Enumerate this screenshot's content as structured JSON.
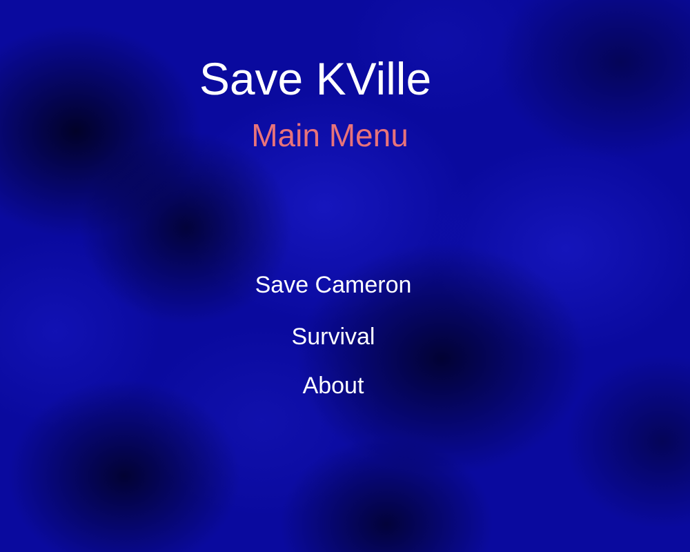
{
  "game": {
    "title": "Save KVille",
    "subtitle": "Main Menu"
  },
  "menu": {
    "items": [
      {
        "label": "Save Cameron"
      },
      {
        "label": "Survival"
      },
      {
        "label": "About"
      }
    ]
  },
  "colors": {
    "background": "#0a0a9e",
    "title": "#ffffff",
    "subtitle": "#e8737a",
    "menu_text": "#ffffff"
  }
}
